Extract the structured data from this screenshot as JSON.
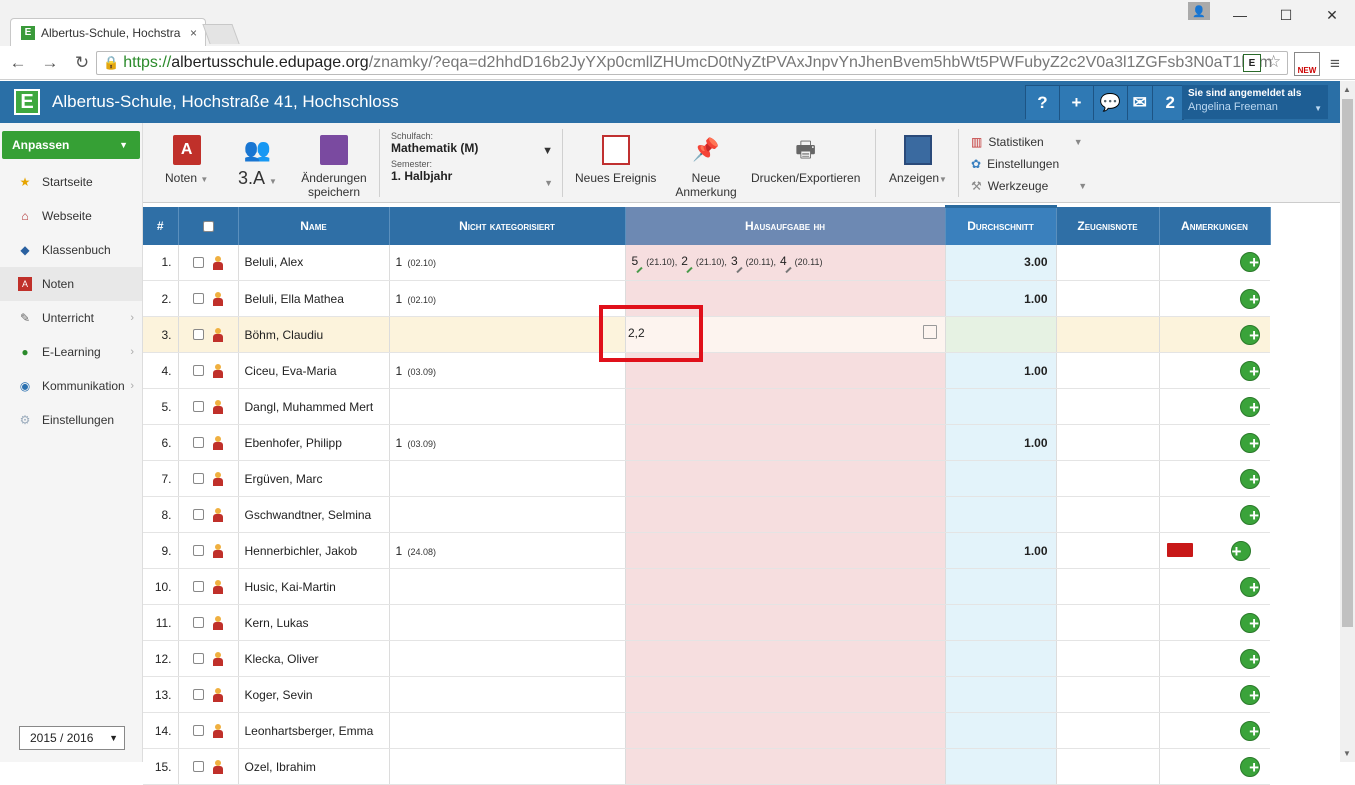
{
  "browser": {
    "tab_title": "Albertus-Schule, Hochstra",
    "tab_close": "×",
    "url_scheme": "https://",
    "url_domain": "albertusschule.edupage.org",
    "url_path": "/znamky/?eqa=d2hhdD16b2JyYXp0cmllZHUmcD0tNyZtPVAxJnpvYnJhenBvem5hbWt5PWFubyZ2c2V0a3l1ZGFsb3N0aT1hbm",
    "ext_new_label": "NEW"
  },
  "app": {
    "title": "Albertus-Schule, Hochstraße 41, Hochschloss",
    "logo": "E",
    "messages_count": "2",
    "login_label": "Sie sind angemeldet als",
    "login_user": "Angelina Freeman"
  },
  "sidebar": {
    "customize": "Anpassen",
    "items": [
      {
        "label": "Startseite"
      },
      {
        "label": "Webseite"
      },
      {
        "label": "Klassenbuch"
      },
      {
        "label": "Noten"
      },
      {
        "label": "Unterricht"
      },
      {
        "label": "E-Learning"
      },
      {
        "label": "Kommunikation"
      },
      {
        "label": "Einstellungen"
      }
    ],
    "year": "2015 / 2016"
  },
  "ribbon": {
    "noten": "Noten",
    "class": "3.A",
    "save": "Änderungen speichern",
    "subject_label": "Schulfach:",
    "subject_value": "Mathematik (M)",
    "semester_label": "Semester:",
    "semester_value": "1. Halbjahr",
    "new_event": "Neues Ereignis",
    "new_note": "Neue Anmerkung",
    "print": "Drucken/Exportieren",
    "view": "Anzeigen",
    "statistics": "Statistiken",
    "settings": "Einstellungen",
    "tools": "Werkzeuge"
  },
  "table": {
    "headers": {
      "num": "#",
      "name": "Name",
      "uncat": "Nicht kategorisiert",
      "hw": "Hausaufgabe hh",
      "avg": "Durchschnitt",
      "report": "Zeugnisnote",
      "notes": "Anmerkungen"
    },
    "edit_value": "2,2",
    "rows": [
      {
        "n": "1.",
        "name": "Beluli, Alex",
        "u_grade": "1",
        "u_date": "(02.10)",
        "hw": [
          {
            "g": "5",
            "d": "(21.10),"
          },
          {
            "g": "2",
            "d": "(21.10),"
          },
          {
            "g": "3",
            "d": "(20.11),"
          },
          {
            "g": "4",
            "d": "(20.11)"
          }
        ],
        "avg": "3.00"
      },
      {
        "n": "2.",
        "name": "Beluli, Ella Mathea",
        "u_grade": "1",
        "u_date": "(02.10)",
        "avg": "1.00"
      },
      {
        "n": "3.",
        "name": "Böhm, Claudiu",
        "u_grade": "",
        "u_date": "",
        "avg": ""
      },
      {
        "n": "4.",
        "name": "Ciceu, Eva-Maria",
        "u_grade": "1",
        "u_date": "(03.09)",
        "avg": "1.00"
      },
      {
        "n": "5.",
        "name": "Dangl, Muhammed Mert",
        "u_grade": "",
        "u_date": "",
        "avg": ""
      },
      {
        "n": "6.",
        "name": "Ebenhofer, Philipp",
        "u_grade": "1",
        "u_date": "(03.09)",
        "avg": "1.00"
      },
      {
        "n": "7.",
        "name": "Ergüven, Marc",
        "u_grade": "",
        "u_date": "",
        "avg": ""
      },
      {
        "n": "8.",
        "name": "Gschwandtner, Selmina",
        "u_grade": "",
        "u_date": "",
        "avg": ""
      },
      {
        "n": "9.",
        "name": "Hennerbichler, Jakob",
        "u_grade": "1",
        "u_date": "(24.08)",
        "avg": "1.00"
      },
      {
        "n": "10.",
        "name": "Husic, Kai-Martin",
        "u_grade": "",
        "u_date": "",
        "avg": ""
      },
      {
        "n": "11.",
        "name": "Kern, Lukas",
        "u_grade": "",
        "u_date": "",
        "avg": ""
      },
      {
        "n": "12.",
        "name": "Klecka, Oliver",
        "u_grade": "",
        "u_date": "",
        "avg": ""
      },
      {
        "n": "13.",
        "name": "Koger, Sevin",
        "u_grade": "",
        "u_date": "",
        "avg": ""
      },
      {
        "n": "14.",
        "name": "Leonhartsberger, Emma",
        "u_grade": "",
        "u_date": "",
        "avg": ""
      },
      {
        "n": "15.",
        "name": "Ozel, Ibrahim",
        "u_grade": "",
        "u_date": "",
        "avg": ""
      }
    ]
  }
}
